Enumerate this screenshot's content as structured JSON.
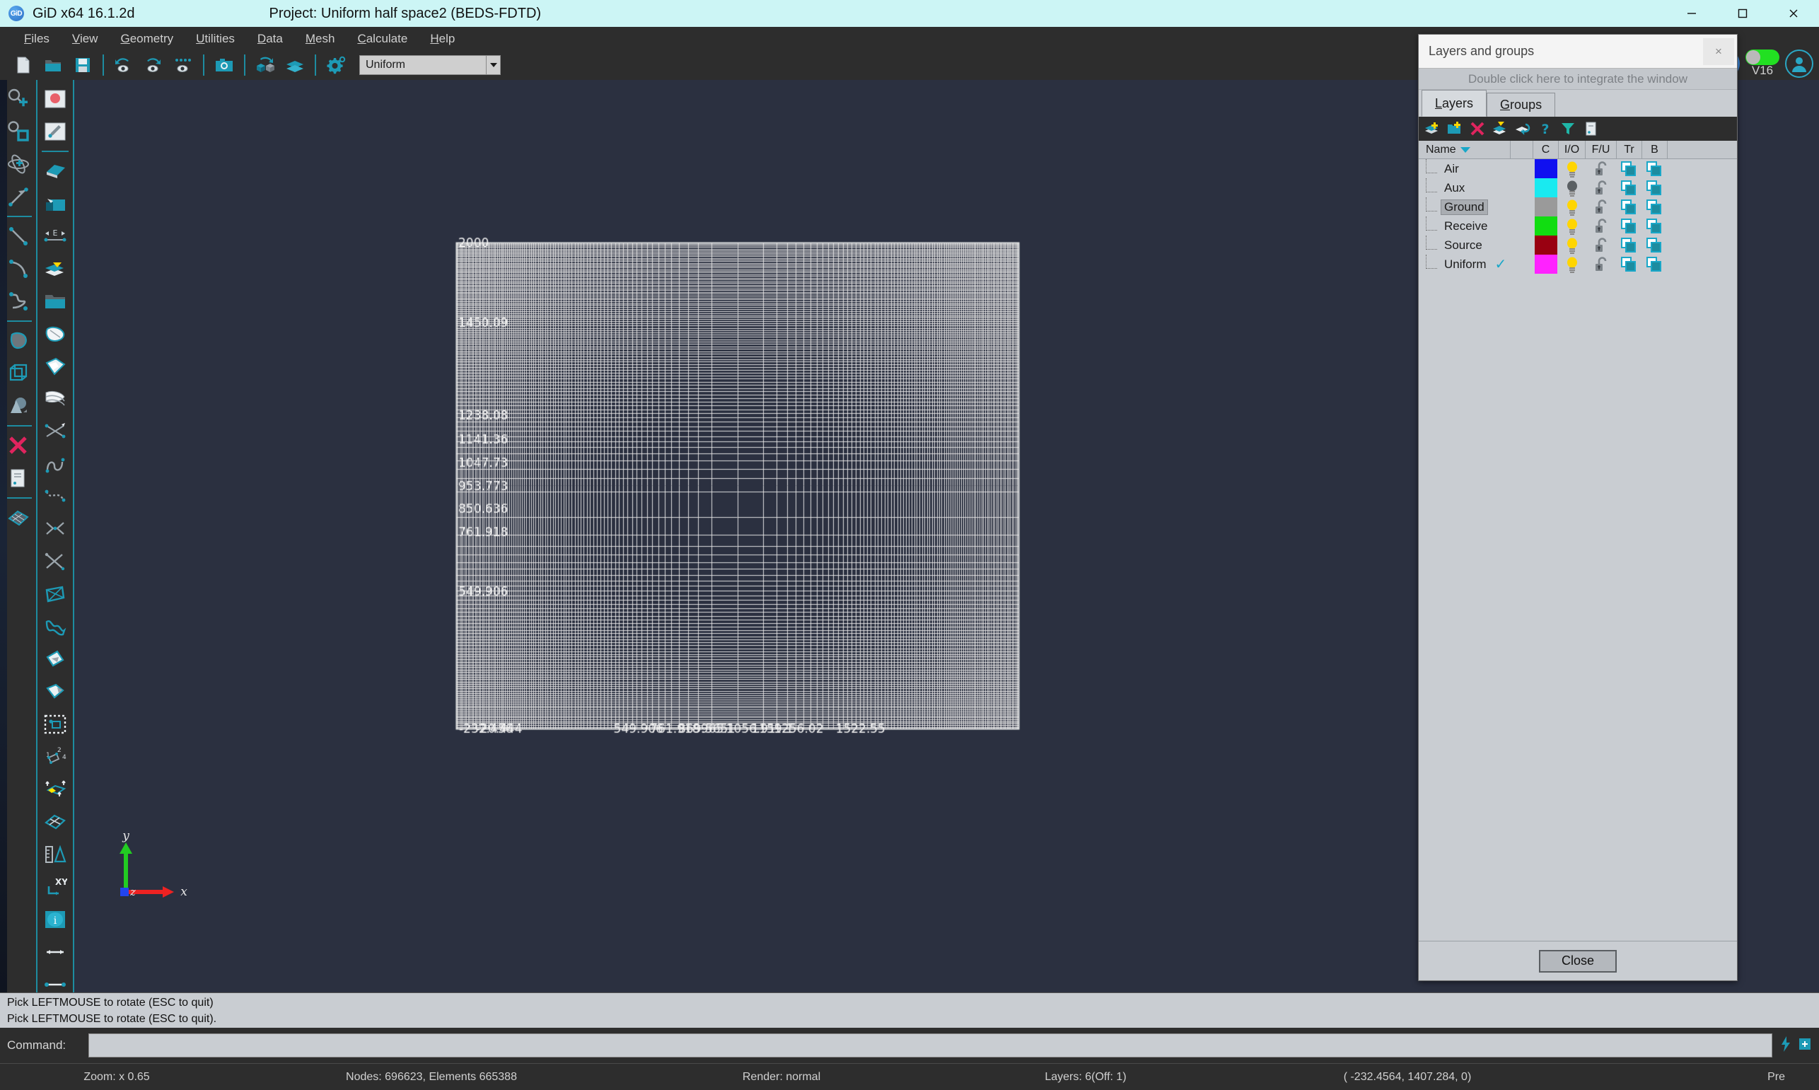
{
  "window": {
    "app_title": "GiD x64 16.1.2d",
    "project_title": "Project: Uniform half space2 (BEDS-FDTD)",
    "logo_text": "GiD",
    "minimize_icon": "minimize-icon",
    "maximize_icon": "maximize-icon",
    "close_icon": "close-icon"
  },
  "menu": {
    "items": [
      {
        "pre": "F",
        "rest": "iles"
      },
      {
        "pre": "V",
        "rest": "iew"
      },
      {
        "pre": "G",
        "rest": "eometry"
      },
      {
        "pre": "U",
        "rest": "tilities"
      },
      {
        "pre": "D",
        "rest": "ata"
      },
      {
        "pre": "M",
        "rest": "esh"
      },
      {
        "pre": "C",
        "rest": "alculate"
      },
      {
        "pre": "H",
        "rest": "elp"
      }
    ]
  },
  "toolbar_top": {
    "buttons": [
      "new-file-icon",
      "open-folder-icon",
      "save-icon",
      "rotate-left-eye-icon",
      "rotate-right-eye-icon",
      "zoom-frame-eye-icon",
      "snapshot-icon",
      "render-cube-icon",
      "layers-stack-icon",
      "preferences-gear-icon"
    ],
    "layer_combo": {
      "value": "Uniform",
      "arrow_icon": "chevron-down-icon"
    }
  },
  "branding": {
    "logo_text": "GiD",
    "version_label": "V16",
    "toggle_state": "on",
    "avatar_icon": "user-avatar-icon"
  },
  "toolbar_left": {
    "column_one": [
      "zoom-in-icon",
      "zoom-window-icon",
      "rotate-trackball-icon",
      "pan-arrow-icon",
      "sep",
      "line-icon",
      "arc-icon",
      "nurbs-curve-icon",
      "sep",
      "surface-icon",
      "volume-cube-icon",
      "solid-sphere-icon",
      "sep",
      "delete-cross-icon",
      "list-entities-icon",
      "sep",
      "mesh-surface-icon"
    ],
    "column_two": [
      "material-red-dot-icon",
      "edit-pencil-icon",
      "sep",
      "create-surface-icon",
      "create-volume-icon",
      "edge-length-icon",
      "layer-move-icon",
      "open-folder2-icon",
      "nurbs-surface-icon",
      "trimmed-surface-icon",
      "contact-surface-icon",
      "intersect-icon",
      "curve-tangent-icon",
      "curve-join-icon",
      "curve-split-icon",
      "collapse-icon",
      "prism-icon",
      "bend-surface-icon",
      "cone-surface-icon",
      "cut-surface-icon",
      "select-window-icon",
      "numbered-points-icon",
      "extrude-icon",
      "mesh-quad-icon",
      "measure-icon",
      "coordinates-xy-icon",
      "info-icon",
      "distance-line-icon",
      "point-line-icon"
    ]
  },
  "viewport": {
    "background_color": "#2b3040",
    "mesh_color": "#e8e8e8",
    "axis_triad": {
      "x_label": "x",
      "y_label": "y",
      "z_label": "z",
      "x_color": "#ee2222",
      "y_color": "#22cc22",
      "z_color": "#2244ee"
    }
  },
  "chart_data": {
    "type": "heatmap",
    "title": "",
    "xlabel": "",
    "ylabel": "",
    "grid": true,
    "legend_position": "none",
    "y_tick_labels": [
      "2000",
      "1450.09",
      "1238.08",
      "1141.36",
      "1047.73",
      "953.773",
      "850.636",
      "761.918",
      "549.906"
    ],
    "y_tick_positions": [
      0.0,
      0.165,
      0.355,
      0.405,
      0.453,
      0.5,
      0.548,
      0.596,
      0.718
    ],
    "x_tick_labels": [
      "-232.456",
      "-20.444",
      "549.906",
      "761.918",
      "869.565",
      "965.1",
      "1056.91",
      "1159.1",
      "1256.02",
      "1522.55"
    ],
    "x_tick_positions": [
      0.005,
      0.035,
      0.28,
      0.345,
      0.395,
      0.435,
      0.48,
      0.525,
      0.565,
      0.675
    ],
    "xlim": [
      -450,
      2400
    ],
    "ylim": [
      -200,
      2000
    ],
    "description": "Graded FDTD rectilinear mesh, dense near center, coarse at edges"
  },
  "layers_panel": {
    "title": "Layers and groups",
    "close_x": "×",
    "integrate_hint": "Double click here to integrate the window",
    "tabs": [
      {
        "pre": "L",
        "rest": "ayers",
        "active": true
      },
      {
        "pre": "G",
        "rest": "roups",
        "active": false
      }
    ],
    "toolbar_icons": [
      "new-layer-icon",
      "new-group-layer-icon",
      "delete-layer-icon",
      "send-to-layer-icon",
      "layer-properties-icon",
      "unknown-layer-icon",
      "filter-layer-icon",
      "layer-report-icon"
    ],
    "columns": [
      "Name",
      "C",
      "I/O",
      "F/U",
      "Tr",
      "B"
    ],
    "rows": [
      {
        "name": "Air",
        "color": "#1010f0",
        "on": true,
        "selected": false,
        "current": false
      },
      {
        "name": "Aux",
        "color": "#19eaf0",
        "on": false,
        "selected": false,
        "current": false
      },
      {
        "name": "Ground",
        "color": "#9a9a9a",
        "on": true,
        "selected": true,
        "current": false
      },
      {
        "name": "Receive",
        "color": "#11dd11",
        "on": true,
        "selected": false,
        "current": false
      },
      {
        "name": "Source",
        "color": "#990011",
        "on": true,
        "selected": false,
        "current": false
      },
      {
        "name": "Uniform",
        "color": "#ff22ff",
        "on": true,
        "selected": false,
        "current": true
      }
    ],
    "close_button": "Close"
  },
  "messages": {
    "line1": "Pick LEFTMOUSE to rotate (ESC to quit)",
    "line2": "Pick LEFTMOUSE to rotate (ESC to quit)."
  },
  "command": {
    "label": "Command:",
    "value": "",
    "placeholder": "",
    "icons": [
      "lightning-icon",
      "expand-icon"
    ]
  },
  "statusbar": {
    "zoom": "Zoom: x 0.65",
    "nodes": "Nodes: 696623, Elements 665388",
    "render": "Render: normal",
    "layers": "Layers: 6(Off: 1)",
    "coords": "( -232.4564,  1407.284,  0)",
    "mode": "Pre"
  }
}
